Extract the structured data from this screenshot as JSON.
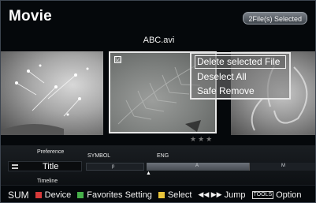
{
  "header": {
    "title": "Movie",
    "selected_badge": "2File(s) Selected"
  },
  "carousel": {
    "current_file": "ABC.avi",
    "center_checkbox": "☑",
    "rating": "★★★"
  },
  "context_menu": {
    "items": [
      {
        "label": "Delete selected File"
      },
      {
        "label": "Deselect All"
      },
      {
        "label": "Safe Remove"
      }
    ]
  },
  "sort_bar": {
    "preference_label": "Preference",
    "symbol_label": "SYMBOL",
    "eng_label": "ENG",
    "title_value": "Title",
    "timeline_label": "Timeline",
    "index_p": "p",
    "index_a": "A",
    "index_m": "M"
  },
  "footer": {
    "sum": "SUM",
    "device": "Device",
    "favorites": "Favorites Setting",
    "select": "Select",
    "jump": "Jump",
    "tools": "TOOLS",
    "option": "Option",
    "device_color": "#d63a3a",
    "favorites_color": "#46b04a",
    "select_color": "#e8c43a",
    "option_color": "#3a7be8"
  }
}
